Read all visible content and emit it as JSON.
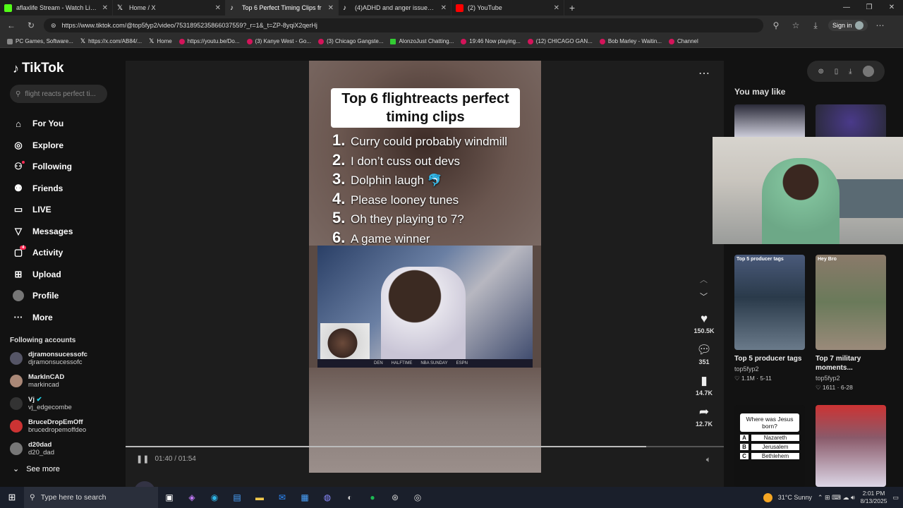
{
  "browser": {
    "tabs": [
      {
        "title": "aflaxlife Stream - Watch Live on K",
        "color": "#53fc18"
      },
      {
        "title": "Home / X",
        "color": "#000000"
      },
      {
        "title": "Top 6 Perfect Timing Clips fr",
        "color": "#25f4ee",
        "active": true
      },
      {
        "title": "(4)ADHD and anger issues (ADHD",
        "color": "#25f4ee"
      },
      {
        "title": "(2) YouTube",
        "color": "#ff0000"
      }
    ],
    "url": "https://www.tiktok.com/@top5fyp2/video/7531895235866037559?_r=1&_t=ZP-8yqiX2qerHj",
    "signin": "Sign in",
    "bookmarks": [
      "PC Games, Software...",
      "https://x.com/AB84/...",
      "Home",
      "https://youtu.be/Do...",
      "(3) Kanye West - Go...",
      "(3) Chicago Gangste...",
      "AlonzoJust Chatting...",
      "19:46 Now playing...",
      "(12) CHICAGO GAN...",
      "Bob Marley - Waitin...",
      "Channel"
    ]
  },
  "sidebar": {
    "brand": "TikTok",
    "search_placeholder": "flight reacts perfect ti...",
    "nav": [
      "For You",
      "Explore",
      "Following",
      "Friends",
      "LIVE",
      "Messages",
      "Activity",
      "Upload",
      "Profile",
      "More"
    ],
    "activity_badge": "4",
    "following_title": "Following accounts",
    "accounts": [
      {
        "name": "djramonsucessofc",
        "handle": "djramonsucessofc"
      },
      {
        "name": "MarkInCAD",
        "handle": "markincad"
      },
      {
        "name": "Vj",
        "handle": "vj_edgecombe"
      },
      {
        "name": "BruceDropEmOff",
        "handle": "brucedropemoffdeo"
      },
      {
        "name": "d20dad",
        "handle": "d20_dad"
      }
    ],
    "see_more": "See more"
  },
  "video": {
    "title_line": "Top 6 flightreacts perfect timing clips",
    "items": [
      {
        "n": "1.",
        "t": "Curry could probably windmill"
      },
      {
        "n": "2.",
        "t": "I don’t cuss out devs"
      },
      {
        "n": "3.",
        "t": "Dolphin laugh 🐬"
      },
      {
        "n": "4.",
        "t": "Please looney tunes"
      },
      {
        "n": "5.",
        "t": "Oh they playing to 7?"
      },
      {
        "n": "6.",
        "t": "A game winner"
      }
    ],
    "scorebar": [
      "DEN",
      "HALFTIME",
      "NBA SUNDAY",
      "ESPN"
    ],
    "time": "01:40 / 01:54",
    "progress": 0.87,
    "likes": "150.5K",
    "comments": "351",
    "saves": "14.7K",
    "shares": "12.7K",
    "author": "top5fyp2"
  },
  "rightrail": {
    "title": "You may like",
    "cards": [
      {
        "title": "Top 5 producer tags",
        "user": "top5fyp2",
        "stats": "♡ 1.1M · 5-11",
        "overlay": "Top 5 producer tags"
      },
      {
        "title": "Top 7 military moments...",
        "user": "top5fyp2",
        "stats": "♡ 1611 · 6-28",
        "overlay": "Hey Bro"
      },
      {
        "quiz_q": "Where was Jesus born?",
        "opts": [
          {
            "l": "A",
            "t": "Nazareth"
          },
          {
            "l": "B",
            "t": "Jerusalem"
          },
          {
            "l": "C",
            "t": "Bethlehem"
          }
        ]
      }
    ]
  },
  "taskbar": {
    "search_placeholder": "Type here to search",
    "weather": "31°C  Sunny",
    "time": "2:01 PM",
    "date": "8/13/2025"
  }
}
